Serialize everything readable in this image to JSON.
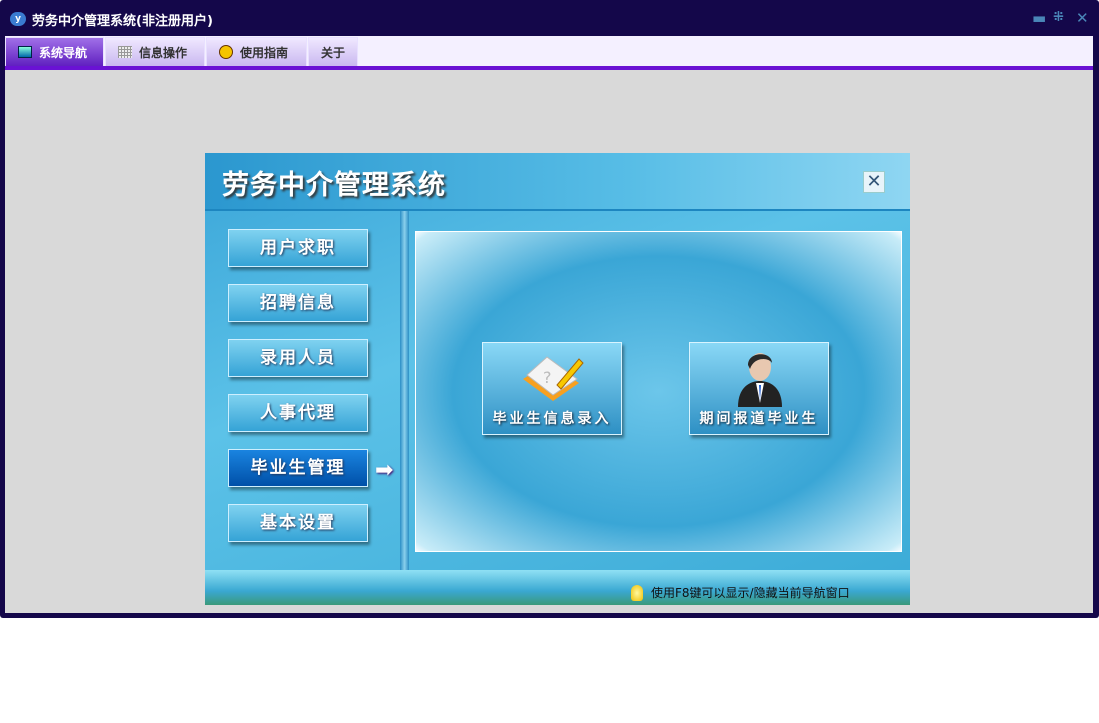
{
  "window": {
    "title": "劳务中介管理系统(非注册用户)",
    "minimize_icon": "minimize-icon",
    "restore_icon": "restore-icon",
    "close_icon": "close-icon"
  },
  "menu": {
    "tabs": [
      {
        "label": "系统导航",
        "active": true
      },
      {
        "label": "信息操作"
      },
      {
        "label": "使用指南"
      },
      {
        "label": "关于"
      }
    ]
  },
  "dialog": {
    "title": "劳务中介管理系统",
    "close": "✕",
    "nav": [
      {
        "label": "用户求职"
      },
      {
        "label": "招聘信息"
      },
      {
        "label": "录用人员"
      },
      {
        "label": "人事代理"
      },
      {
        "label": "毕业生管理",
        "active": true
      },
      {
        "label": "基本设置"
      }
    ],
    "tiles": [
      {
        "label": "毕业生信息录入",
        "icon": "notebook-pencil-icon"
      },
      {
        "label": "期间报道毕业生",
        "icon": "businessman-icon"
      }
    ],
    "footer_tip": "使用F8键可以显示/隐藏当前导航窗口"
  }
}
